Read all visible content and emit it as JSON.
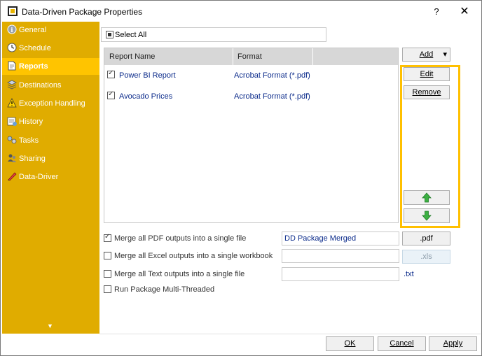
{
  "window": {
    "title": "Data-Driven Package Properties",
    "help": "?",
    "close": "✕"
  },
  "sidebar": {
    "items": [
      {
        "label": "General",
        "icon": "info-icon"
      },
      {
        "label": "Schedule",
        "icon": "clock-icon"
      },
      {
        "label": "Reports",
        "icon": "document-icon",
        "active": true
      },
      {
        "label": "Destinations",
        "icon": "destinations-icon"
      },
      {
        "label": "Exception Handling",
        "icon": "warning-icon"
      },
      {
        "label": "History",
        "icon": "history-icon"
      },
      {
        "label": "Tasks",
        "icon": "tasks-icon"
      },
      {
        "label": "Sharing",
        "icon": "sharing-icon"
      },
      {
        "label": "Data-Driver",
        "icon": "data-driver-icon"
      }
    ],
    "more": "▼"
  },
  "select_all": {
    "label": "Select All"
  },
  "grid": {
    "columns": [
      "Report Name",
      "Format"
    ],
    "rows": [
      {
        "name": "Power BI Report",
        "format": "Acrobat Format (*.pdf)",
        "checked": true
      },
      {
        "name": "Avocado Prices",
        "format": "Acrobat Format (*.pdf)",
        "checked": true
      }
    ]
  },
  "buttons": {
    "add": "Add",
    "add_arrow": "▾",
    "edit": "Edit",
    "remove": "Remove"
  },
  "options": {
    "merge_pdf": {
      "label": "Merge all PDF outputs into a single file",
      "checked": true,
      "value": "DD Package Merged",
      "ext": ".pdf"
    },
    "merge_excel": {
      "label": "Merge all Excel outputs into a single workbook",
      "checked": false,
      "value": "",
      "ext": ".xls"
    },
    "merge_text": {
      "label": "Merge all Text outputs into a single file",
      "checked": false,
      "value": "",
      "ext": ".txt"
    },
    "multi_thread": {
      "label": "Run Package Multi-Threaded",
      "checked": false
    }
  },
  "footer": {
    "ok": "OK",
    "cancel": "Cancel",
    "apply": "Apply"
  },
  "colors": {
    "sidebar": "#e0ac00",
    "sidebar_active": "#ffc400",
    "highlight": "#ffc000",
    "link": "#0a2a8a"
  }
}
